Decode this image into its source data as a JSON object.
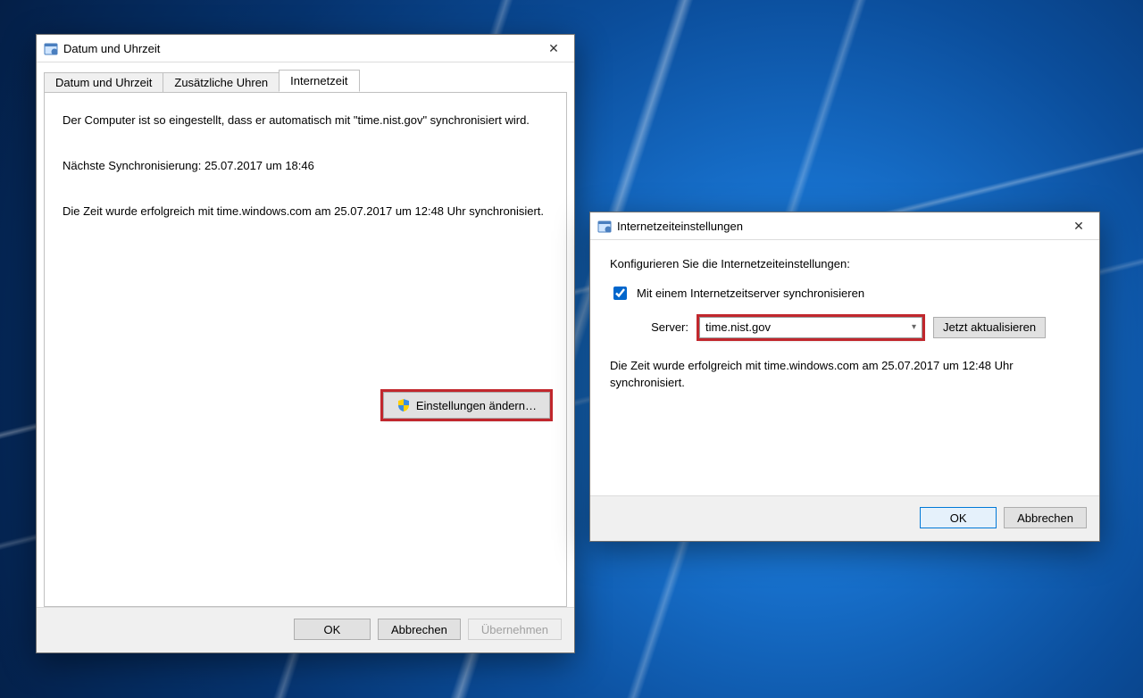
{
  "window1": {
    "title": "Datum und Uhrzeit",
    "tabs": [
      "Datum und Uhrzeit",
      "Zusätzliche Uhren",
      "Internetzeit"
    ],
    "active_tab_index": 2,
    "p1": "Der Computer ist so eingestellt, dass er automatisch mit \"time.nist.gov\" synchronisiert wird.",
    "p2": "Nächste Synchronisierung: 25.07.2017 um 18:46",
    "p3": "Die Zeit wurde erfolgreich mit time.windows.com am 25.07.2017 um 12:48 Uhr synchronisiert.",
    "change_settings_label": "Einstellungen ändern…",
    "ok": "OK",
    "cancel": "Abbrechen",
    "apply": "Übernehmen"
  },
  "window2": {
    "title": "Internetzeiteinstellungen",
    "intro": "Konfigurieren Sie die Internetzeiteinstellungen:",
    "checkbox_label": "Mit einem Internetzeitserver synchronisieren",
    "checkbox_checked": true,
    "server_label": "Server:",
    "server_value": "time.nist.gov",
    "update_now": "Jetzt aktualisieren",
    "status": "Die Zeit wurde erfolgreich mit time.windows.com am 25.07.2017 um 12:48 Uhr synchronisiert.",
    "ok": "OK",
    "cancel": "Abbrechen"
  }
}
